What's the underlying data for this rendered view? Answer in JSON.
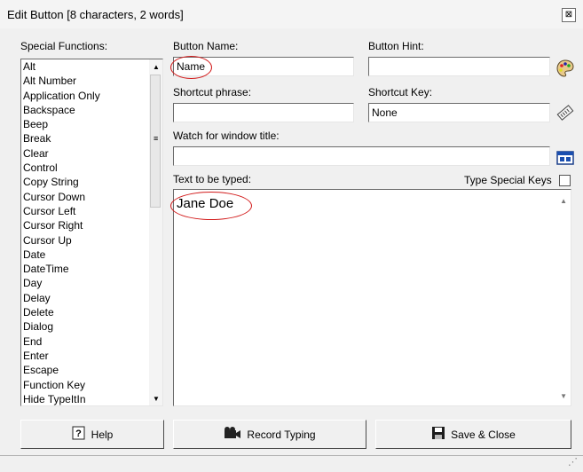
{
  "dialog": {
    "title": "Edit Button [8 characters, 2 words]",
    "close_glyph": "⊠"
  },
  "special_functions": {
    "label": "Special Functions:",
    "items": [
      "Alt",
      "Alt Number",
      "Application Only",
      "Backspace",
      "Beep",
      "Break",
      "Clear",
      "Control",
      "Copy String",
      "Cursor Down",
      "Cursor Left",
      "Cursor Right",
      "Cursor Up",
      "Date",
      "DateTime",
      "Day",
      "Delay",
      "Delete",
      "Dialog",
      "End",
      "Enter",
      "Escape",
      "Function Key",
      "Hide TypeItIn"
    ]
  },
  "button_name": {
    "label": "Button Name:",
    "value": "Name"
  },
  "button_hint": {
    "label": "Button Hint:",
    "value": ""
  },
  "shortcut_phrase": {
    "label": "Shortcut phrase:",
    "value": ""
  },
  "shortcut_key": {
    "label": "Shortcut Key:",
    "value": "None"
  },
  "window_title": {
    "label": "Watch for window title:",
    "value": ""
  },
  "text_to_type": {
    "label": "Text to be typed:",
    "value": "Jane Doe"
  },
  "type_special_keys": {
    "label": "Type Special Keys",
    "checked": false
  },
  "buttons": {
    "help": "Help",
    "record": "Record Typing",
    "save_close": "Save & Close"
  },
  "icons": {
    "palette": "palette-icon",
    "keyboard": "keyboard-icon",
    "window": "window-picker-icon",
    "help": "help-icon",
    "record": "camera-icon",
    "save": "floppy-disk-icon"
  },
  "annotation_color": "#d21a1a"
}
